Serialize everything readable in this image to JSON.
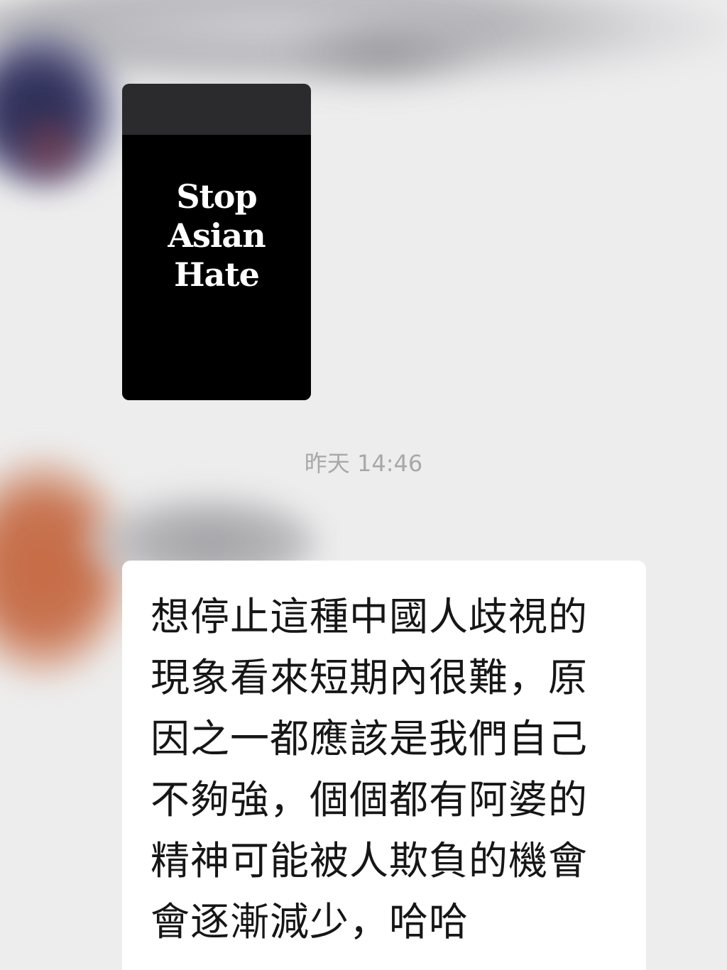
{
  "chat": {
    "image_message": {
      "poster_lines": [
        "Stop",
        "Asian",
        "Hate"
      ]
    },
    "timestamp": "昨天 14:46",
    "text_message": {
      "lines": [
        "想停止這種中國人歧視的",
        "現象看來短期內很難，原",
        "因之一都應該是我們自己",
        "不夠強，個個都有阿婆的",
        "精神可能被人欺負的機會",
        "會逐漸減少，哈哈"
      ]
    }
  },
  "colors": {
    "chat_background": "#ededed",
    "bubble_background": "#ffffff",
    "timestamp_text": "#a8a8a8",
    "poster_background": "#000000"
  }
}
